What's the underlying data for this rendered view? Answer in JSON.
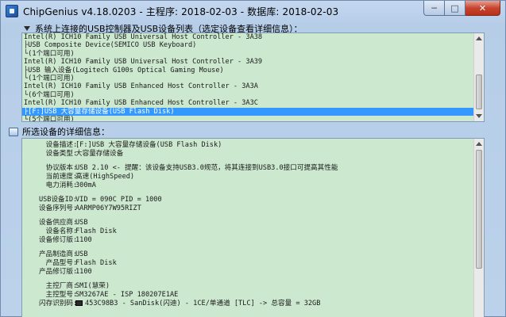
{
  "window": {
    "title": "ChipGenius v4.18.0203 - 主程序: 2018-02-03 - 数据库: 2018-02-03",
    "min_label": "─",
    "max_label": "□",
    "close_label": "✕"
  },
  "device_list": {
    "label": "系统上连接的USB控制器及USB设备列表（选定设备查看详细信息）：",
    "rows": [
      "Intel(R) ICH10 Family USB Universal Host Controller - 3A38",
      "├USB Composite Device(SEMICO USB Keyboard)",
      "└(1个端口可用)",
      "Intel(R) ICH10 Family USB Universal Host Controller - 3A39",
      "├USB 输入设备(Logitech G100s Optical Gaming Mouse)",
      "└(1个端口可用)",
      "Intel(R) ICH10 Family USB Enhanced Host Controller - 3A3A",
      "└(6个端口可用)",
      "Intel(R) ICH10 Family USB Enhanced Host Controller - 3A3C",
      "├[F:]USB 大容量存储设备(USB Flash Disk)",
      "└(5个端口可用)"
    ],
    "selected_index": 9
  },
  "details": {
    "label": "所选设备的详细信息：",
    "rows": [
      {
        "key": "设备描述",
        "value": "[F:]USB 大容量存储设备(USB Flash Disk)"
      },
      {
        "key": "设备类型",
        "value": "大容量存储设备"
      },
      {
        "gap": true
      },
      {
        "key": "协议版本",
        "value": "USB 2.10 <- 提醒：该设备支持USB3.0规范，将其连接到USB3.0接口可提高其性能"
      },
      {
        "key": "当前速度",
        "value": "高速(HighSpeed)"
      },
      {
        "key": "电力消耗",
        "value": "300mA"
      },
      {
        "gap": true
      },
      {
        "key": "USB设备ID",
        "value": "VID = 090C PID = 1000"
      },
      {
        "key": "设备序列号",
        "value": "AARMP06Y7W95RIZT"
      },
      {
        "gap": true
      },
      {
        "key": "设备供应商",
        "value": "USB"
      },
      {
        "key": "设备名称",
        "value": "Flash Disk"
      },
      {
        "key": "设备修订版",
        "value": "1100"
      },
      {
        "gap": true
      },
      {
        "key": "产品制造商",
        "value": "USB"
      },
      {
        "key": "产品型号",
        "value": "Flash Disk"
      },
      {
        "key": "产品修订版",
        "value": "1100"
      },
      {
        "gap": true
      },
      {
        "key": "主控厂商",
        "value": "SMI(慧荣)"
      },
      {
        "key": "主控型号",
        "value": "SM3267AE - ISP 180207E1AE"
      },
      {
        "key": "闪存识别码",
        "value": "453C98B3 - SanDisk(闪迪) - 1CE/单通道 [TLC] -> 总容量 = 32GB",
        "chip": true
      }
    ]
  }
}
